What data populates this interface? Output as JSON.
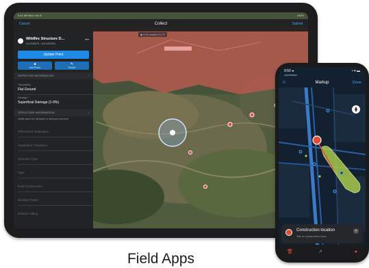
{
  "ipad": {
    "status_left": "9:41 AM  Mon Jun 8",
    "status_right": "100%",
    "nav": {
      "cancel": "Cancel",
      "title": "Collect",
      "submit": "Submit"
    },
    "location_chip": "◆ 0.01 meters 3.1°F",
    "panel": {
      "feature_title": "Wildfire Structure D...",
      "feature_coords": "34.0546875, -118.0000000",
      "more": "•••",
      "update_button": "Update Point",
      "action_left": "Add Photo",
      "action_right": "Sketch",
      "sections": [
        {
          "title": "INSPECTOR INFORMATION"
        },
        {
          "title": "STRUCTURE INFORMATION"
        }
      ],
      "fields": [
        {
          "label": "Topography",
          "value": "Flat Ground"
        },
        {
          "label": "Damage *",
          "value": "Superficial Damage (1-9%)"
        }
      ],
      "structure_desc": "details about the damaged or destroyed structure",
      "dim_fields": [
        "PREVIOUS Evaluation",
        "Vegetation Clearance",
        "Structure Type",
        "Type",
        "Roof Construction",
        "Window Panes",
        "Exterior Siding"
      ]
    }
  },
  "iphone": {
    "status_time": "9:50 ◂",
    "status_right": "▪ ▾ ▬",
    "back": "◂ ArcMarker",
    "title": "Markup",
    "done": "Done",
    "card": {
      "title": "Construction location",
      "subtitle": "Site of construction work"
    }
  },
  "caption": "Field Apps",
  "colors": {
    "accent": "#1f8ae6",
    "burn_zone": "#b65a4f",
    "marker_red": "#e24d36",
    "highlight_green": "#a8c94a"
  }
}
